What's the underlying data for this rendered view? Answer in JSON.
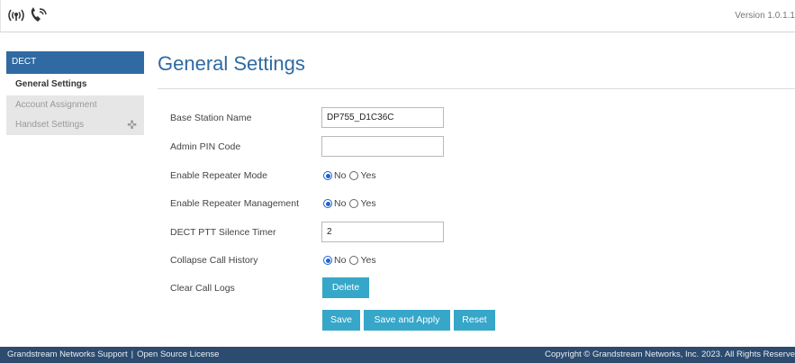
{
  "header": {
    "version": "Version 1.0.1.1"
  },
  "sidebar": {
    "section": "DECT",
    "items": [
      {
        "label": "General Settings"
      },
      {
        "label": "Account Assignment"
      },
      {
        "label": "Handset Settings"
      }
    ]
  },
  "main": {
    "title": "General Settings",
    "fields": {
      "base_station_name": {
        "label": "Base Station Name",
        "value": "DP755_D1C36C"
      },
      "admin_pin": {
        "label": "Admin PIN Code",
        "value": ""
      },
      "repeater_mode": {
        "label": "Enable Repeater Mode",
        "no": "No",
        "yes": "Yes",
        "selected": "No"
      },
      "repeater_management": {
        "label": "Enable Repeater Management",
        "no": "No",
        "yes": "Yes",
        "selected": "No"
      },
      "ptt_timer": {
        "label": "DECT PTT Silence Timer",
        "value": "2"
      },
      "collapse_history": {
        "label": "Collapse Call History",
        "no": "No",
        "yes": "Yes",
        "selected": "No"
      },
      "clear_logs": {
        "label": "Clear Call Logs",
        "button": "Delete"
      }
    },
    "actions": {
      "save": "Save",
      "save_apply": "Save and Apply",
      "reset": "Reset"
    }
  },
  "footer": {
    "support": "Grandstream Networks Support",
    "separator": "|",
    "license": "Open Source License",
    "copyright": "Copyright © Grandstream Networks, Inc. 2023. All Rights Reserve"
  },
  "colors": {
    "accent": "#2f6aa3",
    "button": "#36a6c9",
    "footer": "#2c4b6e"
  }
}
